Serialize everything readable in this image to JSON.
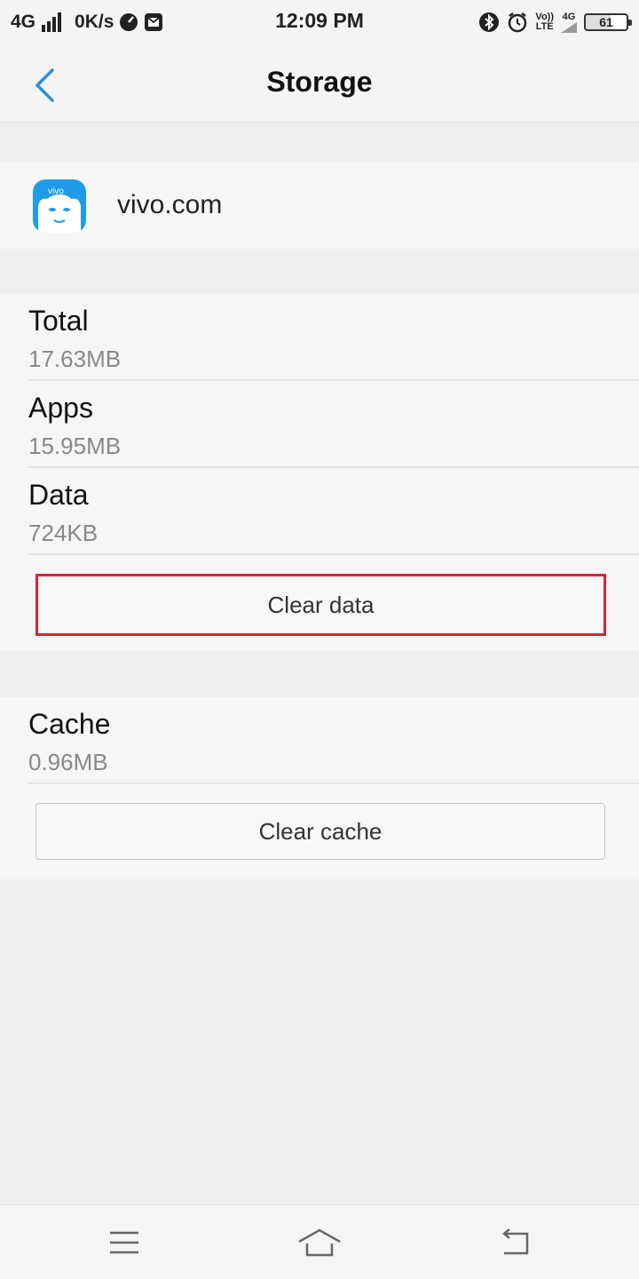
{
  "status_bar": {
    "network": "4G",
    "speed": "0K/s",
    "time": "12:09 PM",
    "volte_top": "Vo))",
    "volte_bottom": "LTE",
    "net_type": "4G",
    "battery": "61"
  },
  "header": {
    "title": "Storage",
    "back_icon": "chevron-left-icon"
  },
  "app": {
    "name": "vivo.com",
    "icon_text": "vivo",
    "icon_color": "#1e9be9"
  },
  "storage": {
    "items": [
      {
        "label": "Total",
        "value": "17.63MB"
      },
      {
        "label": "Apps",
        "value": "15.95MB"
      },
      {
        "label": "Data",
        "value": "724KB"
      }
    ],
    "clear_data_label": "Clear data"
  },
  "cache": {
    "label": "Cache",
    "value": "0.96MB",
    "clear_cache_label": "Clear cache"
  },
  "nav_bar": {
    "menu_icon": "menu-icon",
    "home_icon": "home-icon",
    "back_icon": "back-icon"
  },
  "colors": {
    "accent": "#2b8fd6",
    "highlight": "#e0202e"
  }
}
